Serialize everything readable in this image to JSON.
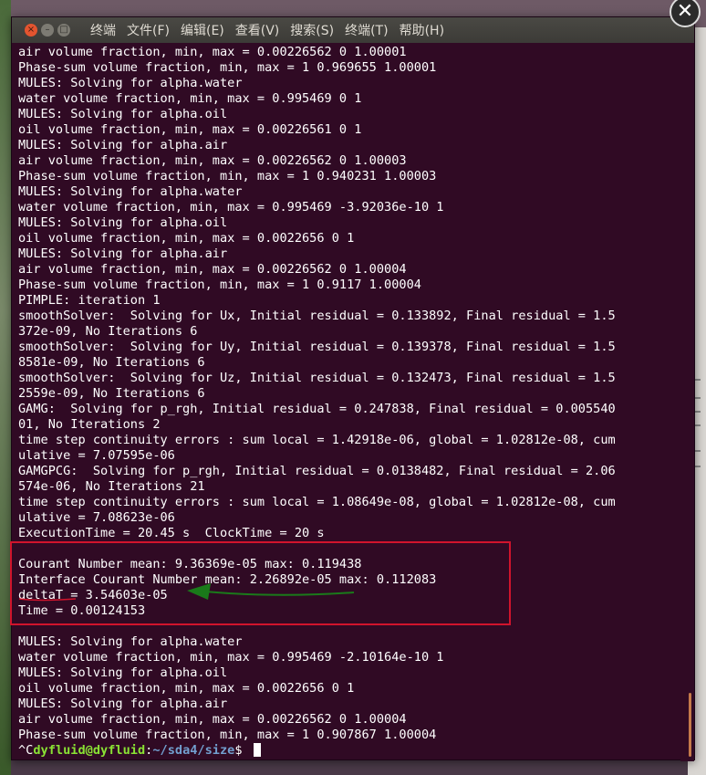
{
  "window": {
    "menu": [
      "终端",
      "文件(F)",
      "编辑(E)",
      "查看(V)",
      "搜索(S)",
      "终端(T)",
      "帮助(H)"
    ],
    "close_glyph": "✕",
    "buttons": {
      "close": "×",
      "minimize": "–",
      "maximize": "□"
    }
  },
  "terminal": {
    "lines": [
      "air volume fraction, min, max = 0.00226562 0 1.00001",
      "Phase-sum volume fraction, min, max = 1 0.969655 1.00001",
      "MULES: Solving for alpha.water",
      "water volume fraction, min, max = 0.995469 0 1",
      "MULES: Solving for alpha.oil",
      "oil volume fraction, min, max = 0.00226561 0 1",
      "MULES: Solving for alpha.air",
      "air volume fraction, min, max = 0.00226562 0 1.00003",
      "Phase-sum volume fraction, min, max = 1 0.940231 1.00003",
      "MULES: Solving for alpha.water",
      "water volume fraction, min, max = 0.995469 -3.92036e-10 1",
      "MULES: Solving for alpha.oil",
      "oil volume fraction, min, max = 0.0022656 0 1",
      "MULES: Solving for alpha.air",
      "air volume fraction, min, max = 0.00226562 0 1.00004",
      "Phase-sum volume fraction, min, max = 1 0.9117 1.00004",
      "PIMPLE: iteration 1",
      "smoothSolver:  Solving for Ux, Initial residual = 0.133892, Final residual = 1.5",
      "372e-09, No Iterations 6",
      "smoothSolver:  Solving for Uy, Initial residual = 0.139378, Final residual = 1.5",
      "8581e-09, No Iterations 6",
      "smoothSolver:  Solving for Uz, Initial residual = 0.132473, Final residual = 1.5",
      "2559e-09, No Iterations 6",
      "GAMG:  Solving for p_rgh, Initial residual = 0.247838, Final residual = 0.005540",
      "01, No Iterations 2",
      "time step continuity errors : sum local = 1.42918e-06, global = 1.02812e-08, cum",
      "ulative = 7.07595e-06",
      "GAMGPCG:  Solving for p_rgh, Initial residual = 0.0138482, Final residual = 2.06",
      "574e-06, No Iterations 21",
      "time step continuity errors : sum local = 1.08649e-08, global = 1.02812e-08, cum",
      "ulative = 7.08623e-06",
      "ExecutionTime = 20.45 s  ClockTime = 20 s",
      "",
      "Courant Number mean: 9.36369e-05 max: 0.119438",
      "Interface Courant Number mean: 2.26892e-05 max: 0.112083",
      "deltaT = 3.54603e-05",
      "Time = 0.00124153",
      "",
      "MULES: Solving for alpha.water",
      "water volume fraction, min, max = 0.995469 -2.10164e-10 1",
      "MULES: Solving for alpha.oil",
      "oil volume fraction, min, max = 0.0022656 0 1",
      "MULES: Solving for alpha.air",
      "air volume fraction, min, max = 0.00226562 0 1.00004",
      "Phase-sum volume fraction, min, max = 1 0.907867 1.00004"
    ],
    "prompt": {
      "prefix": "^C",
      "user_host": "dyfluid@dyfluid",
      "separator": ":",
      "path": "~/sda4/size",
      "symbol": "$ "
    }
  },
  "colors": {
    "terminal_bg": "#300a24",
    "prompt_user": "#8ae234",
    "prompt_path": "#729fcf",
    "highlight_box": "#d0142c",
    "arrow": "#1a7a1a",
    "underline": "#d0142c"
  }
}
